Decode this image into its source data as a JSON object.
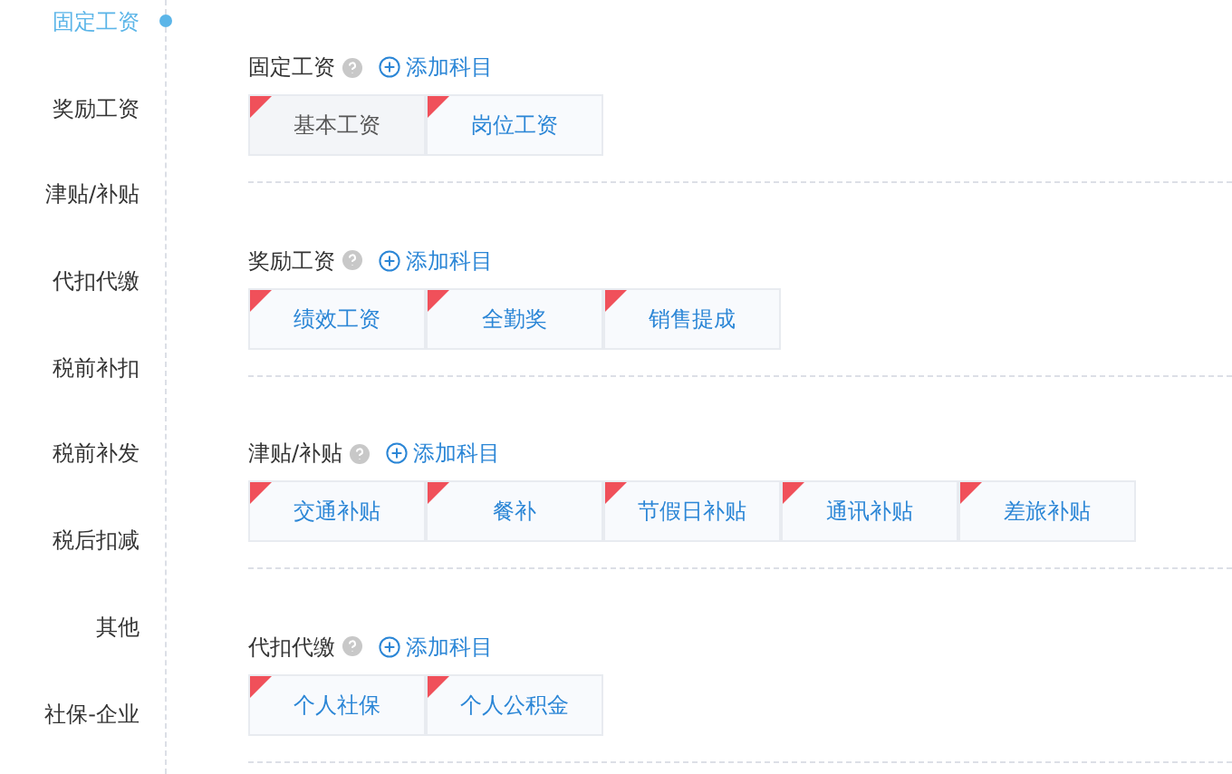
{
  "nav": [
    {
      "label": "固定工资",
      "selected": true
    },
    {
      "label": "奖励工资",
      "selected": false
    },
    {
      "label": "津贴/补贴",
      "selected": false
    },
    {
      "label": "代扣代缴",
      "selected": false
    },
    {
      "label": "税前补扣",
      "selected": false
    },
    {
      "label": "税前补发",
      "selected": false
    },
    {
      "label": "税后扣减",
      "selected": false
    },
    {
      "label": "其他",
      "selected": false
    },
    {
      "label": "社保-企业",
      "selected": false
    }
  ],
  "sections": [
    {
      "title": "固定工资",
      "add_label": "添加科目",
      "items": [
        {
          "label": "基本工资",
          "disabled": true
        },
        {
          "label": "岗位工资",
          "disabled": false
        }
      ]
    },
    {
      "title": "奖励工资",
      "add_label": "添加科目",
      "items": [
        {
          "label": "绩效工资",
          "disabled": false
        },
        {
          "label": "全勤奖",
          "disabled": false
        },
        {
          "label": "销售提成",
          "disabled": false
        }
      ]
    },
    {
      "title": "津贴/补贴",
      "add_label": "添加科目",
      "items": [
        {
          "label": "交通补贴",
          "disabled": false
        },
        {
          "label": "餐补",
          "disabled": false
        },
        {
          "label": "节假日补贴",
          "disabled": false
        },
        {
          "label": "通讯补贴",
          "disabled": false
        },
        {
          "label": "差旅补贴",
          "disabled": false
        }
      ]
    },
    {
      "title": "代扣代缴",
      "add_label": "添加科目",
      "items": [
        {
          "label": "个人社保",
          "disabled": false
        },
        {
          "label": "个人公积金",
          "disabled": false
        }
      ]
    }
  ]
}
